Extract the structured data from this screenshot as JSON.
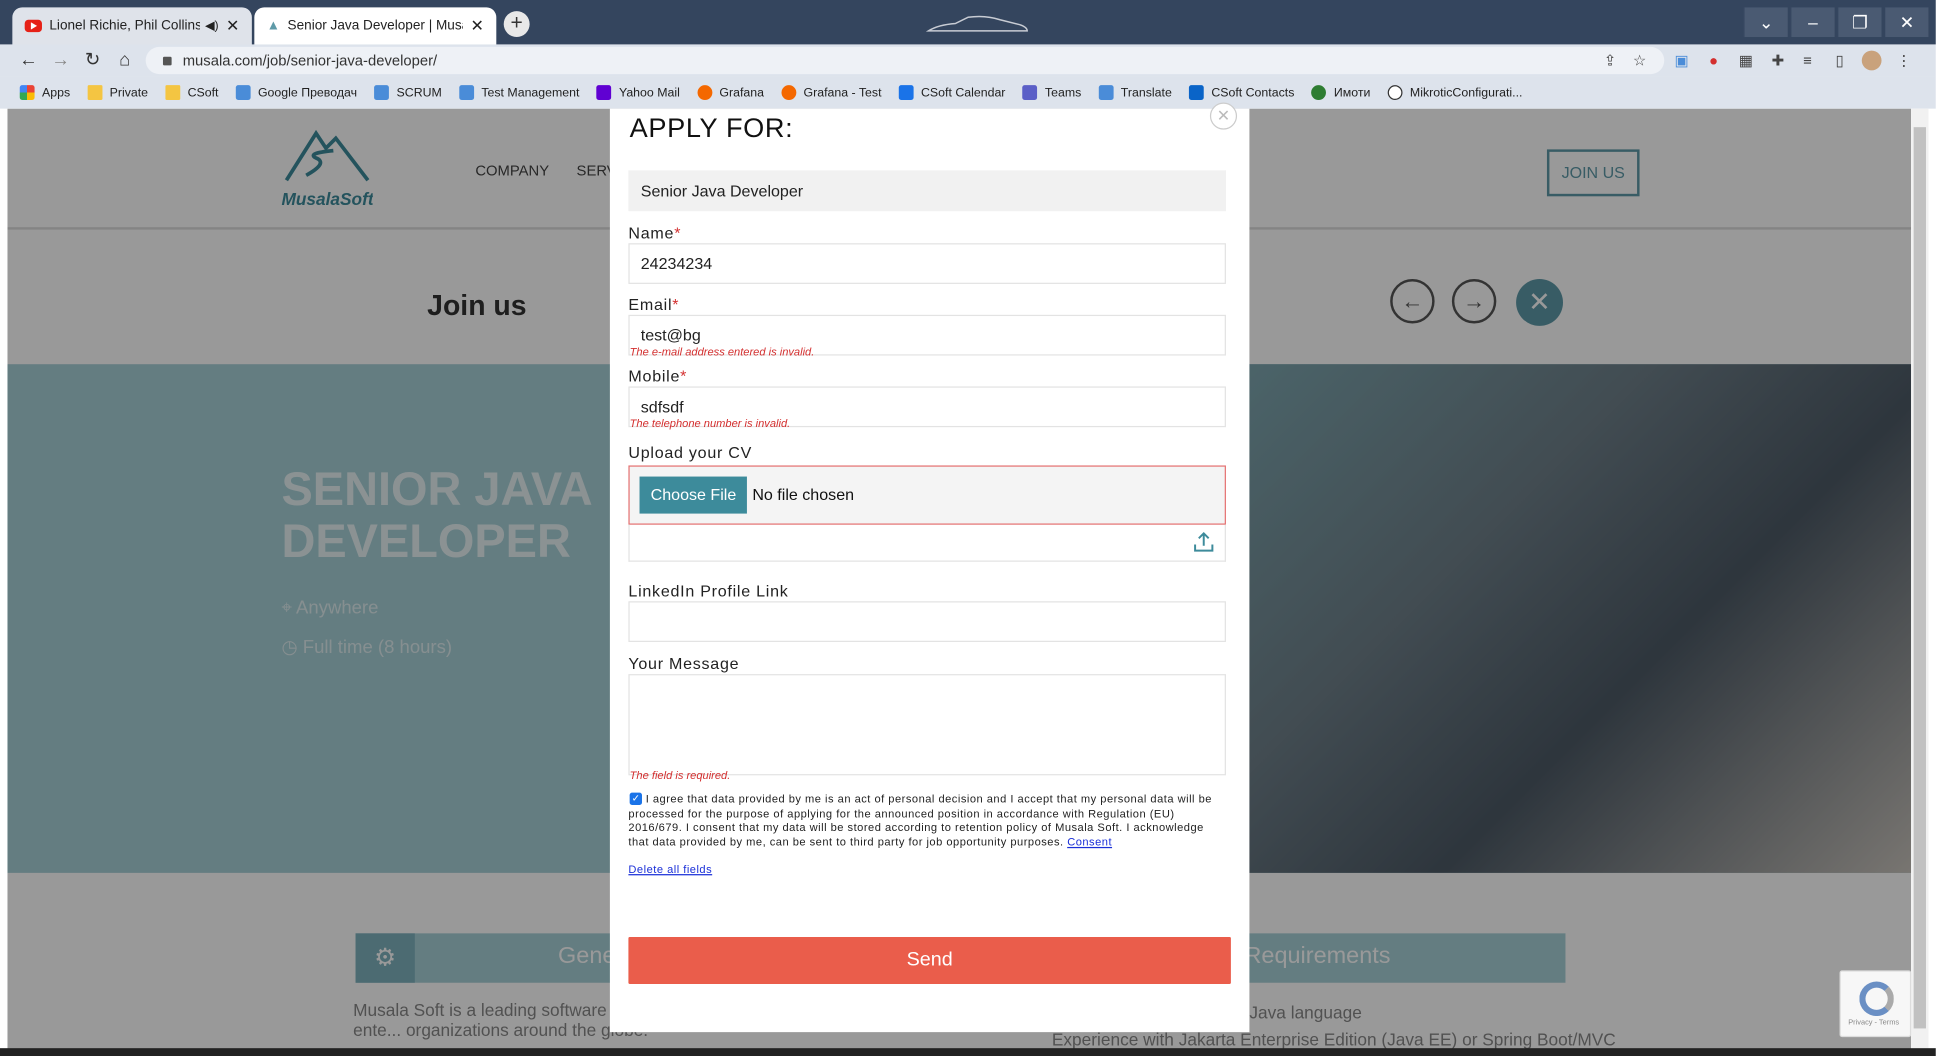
{
  "browser": {
    "tabs": [
      {
        "title": "Lionel Richie, Phil Collins, Ro",
        "close": "✕"
      },
      {
        "title": "Senior Java Developer | Musala S",
        "close": "✕"
      }
    ],
    "new_tab": "+",
    "window_controls": [
      "⌄",
      "–",
      "❐",
      "✕"
    ],
    "url": "musala.com/job/senior-java-developer/",
    "bookmarks": [
      "Apps",
      "Private",
      "CSoft",
      "Google Преводач",
      "SCRUM",
      "Test Management",
      "Yahoo Mail",
      "Grafana",
      "Grafana - Test",
      "CSoft Calendar",
      "Teams",
      "Translate",
      "CSoft Contacts",
      "Имоти",
      "MikroticConfigurati..."
    ]
  },
  "site": {
    "logo_text": "MusalaSoft",
    "menu": [
      "COMPANY",
      "SERV"
    ],
    "join_us_button": "JOIN US",
    "join_us_title": "Join us",
    "prev": "←",
    "next": "→",
    "close": "✕",
    "job_title_line1": "SENIOR JAVA",
    "job_title_line2": "DEVELOPER",
    "location": "Anywhere",
    "employment": "Full time (8 hours)",
    "general_heading": "Gene",
    "requirements_heading": "Requirements",
    "body_text": "Musala Soft is a leading software se... of success in building innovative ente... organizations around the globe.",
    "req_line1": "Java language",
    "req_line2": "Experience with Jakarta Enterprise Edition (Java EE) or Spring Boot/MVC"
  },
  "modal": {
    "title": "APPLY FOR:",
    "close": "✕",
    "job": "Senior Java Developer",
    "name_label": "Name",
    "name_value": "24234234",
    "email_label": "Email",
    "email_value": "test@bg",
    "email_error": "The e-mail address entered is invalid.",
    "mobile_label": "Mobile",
    "mobile_value": "sdfsdf",
    "mobile_error": "The telephone number is invalid.",
    "cv_label": "Upload your CV",
    "choose_file": "Choose File",
    "no_file": "No file chosen",
    "linkedin_label": "LinkedIn Profile Link",
    "message_label": "Your Message",
    "message_error": "The field is required.",
    "required_mark": "*",
    "consent_text": "I agree that data provided by me is an act of personal decision and I accept that my personal data will be processed for the purpose of applying for the announced position in accordance with Regulation (EU) 2016/679. I consent that my data will be stored according to retention policy of Musala Soft. I acknowledge that data provided by me, can be sent to third party for job opportunity purposes.",
    "consent_link": "Consent",
    "delete_link": "Delete all fields",
    "send": "Send",
    "checked": true
  },
  "recaptcha": {
    "text": "Privacy - Terms"
  },
  "colors": {
    "accent": "#3d8b9b",
    "send": "#ea5d4b",
    "error": "#d32f2f",
    "tabbar": "#34455e"
  }
}
